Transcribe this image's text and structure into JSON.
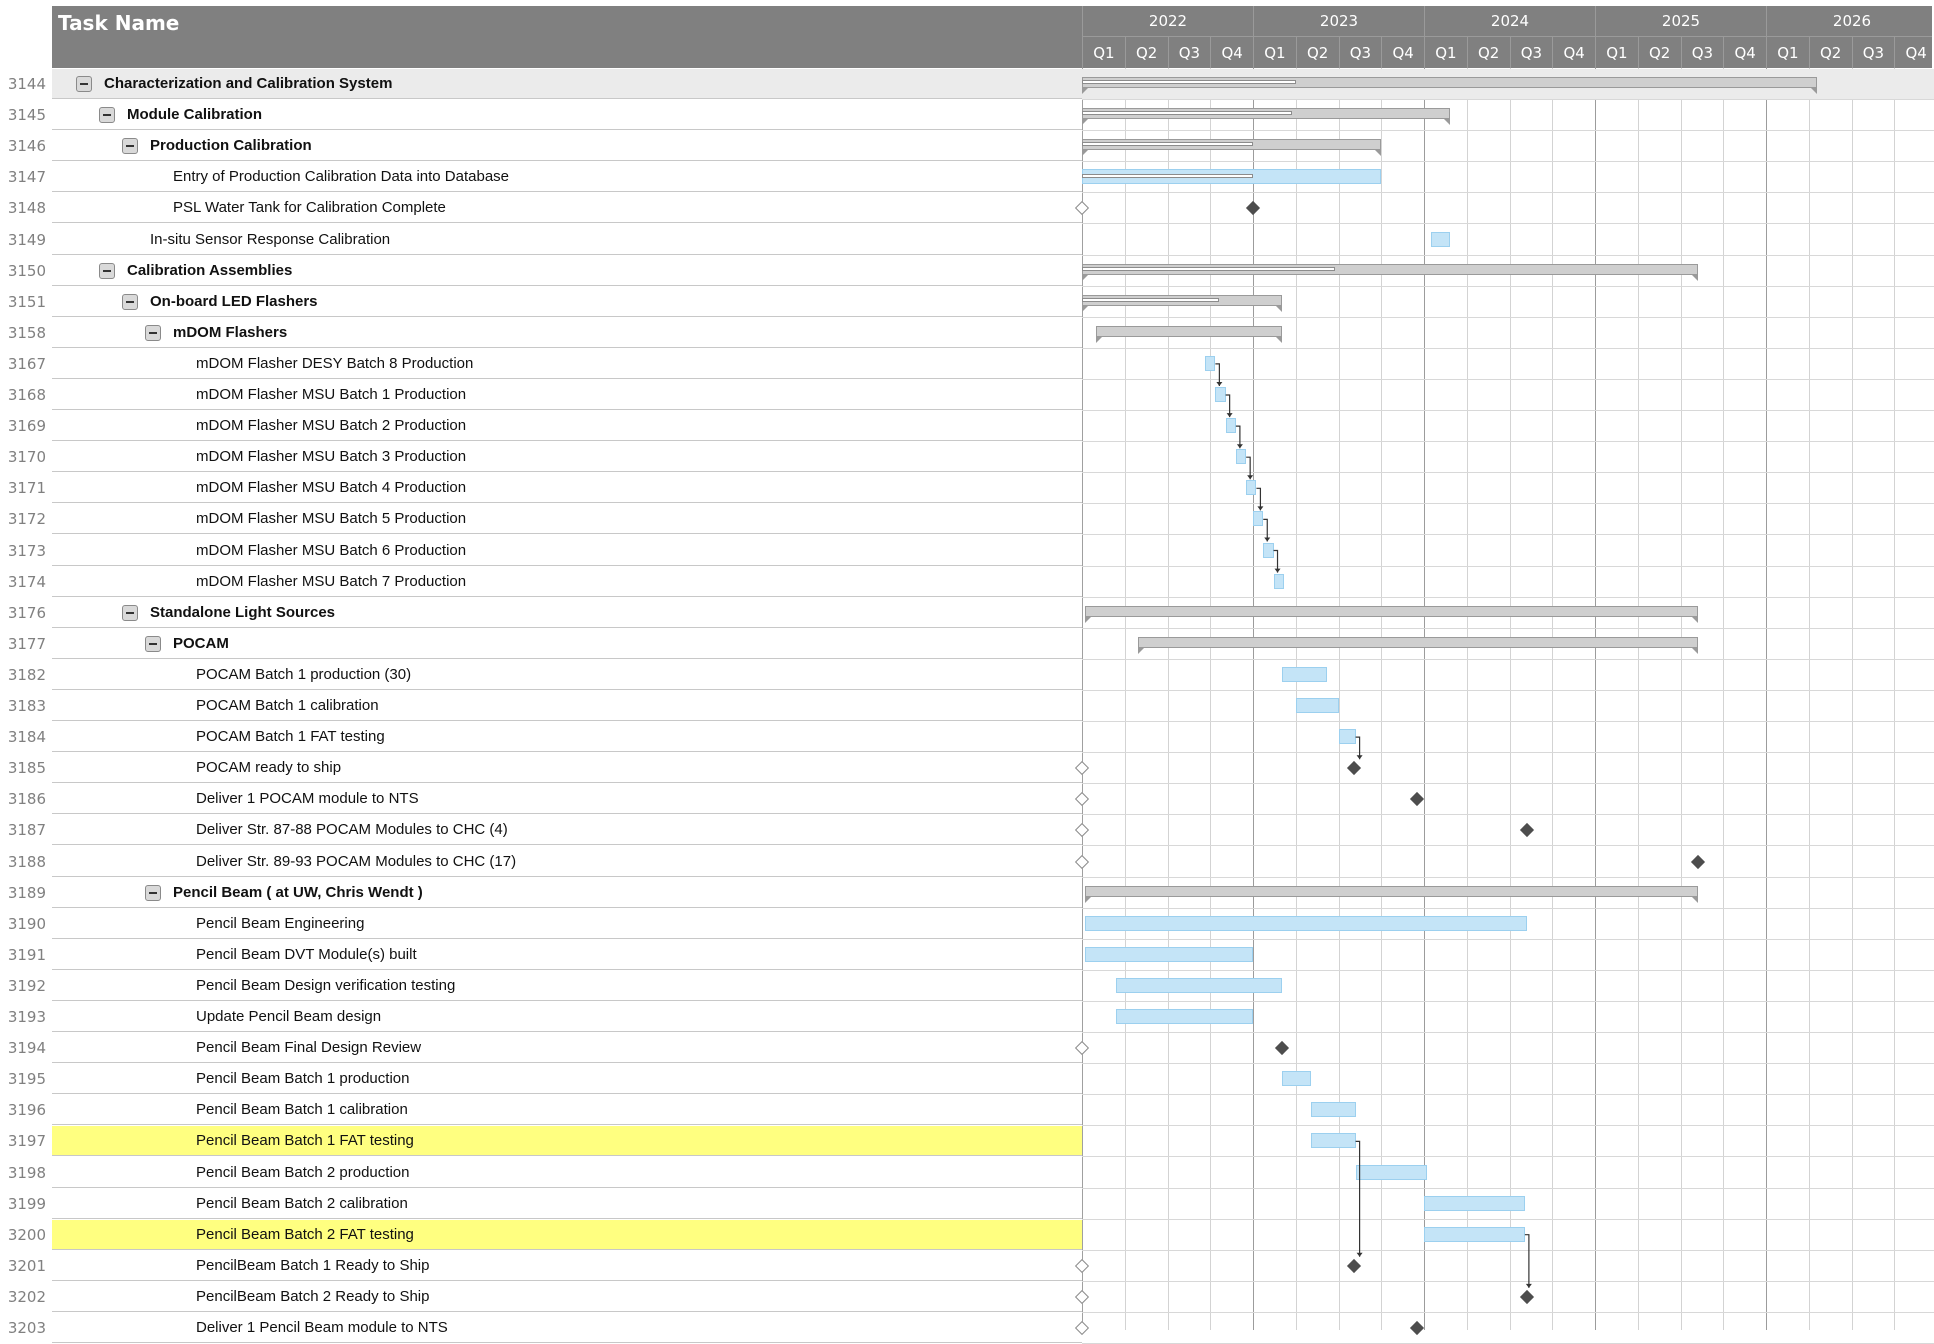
{
  "header": {
    "task_name_label": "Task Name",
    "years": [
      "2022",
      "2023",
      "2024",
      "2025",
      "2026"
    ],
    "quarters": [
      "Q1",
      "Q2",
      "Q3",
      "Q4"
    ]
  },
  "colors": {
    "header_bg": "#808080",
    "task_bar": "#c4e4f7",
    "summary_bar": "#cfcfcf",
    "milestone": "#4d4d4d",
    "highlight": "#ffff80"
  },
  "rows": [
    {
      "id": "3144",
      "name": "Characterization and Calibration System",
      "level": 0,
      "summary": true,
      "top": true,
      "bar": {
        "type": "summary",
        "start": 0.0,
        "end": 4.3,
        "progress": 1.25
      }
    },
    {
      "id": "3145",
      "name": "Module Calibration",
      "level": 1,
      "summary": true,
      "bar": {
        "type": "summary",
        "start": 0.0,
        "end": 2.15,
        "progress": 1.23
      }
    },
    {
      "id": "3146",
      "name": "Production Calibration",
      "level": 2,
      "summary": true,
      "bar": {
        "type": "summary",
        "start": 0.0,
        "end": 1.75,
        "progress": 1.0
      }
    },
    {
      "id": "3147",
      "name": "Entry of Production Calibration Data into Database",
      "level": 3,
      "summary": false,
      "bar": {
        "type": "task",
        "start": 0.0,
        "end": 1.75,
        "progress": 1.0
      }
    },
    {
      "id": "3148",
      "name": "PSL Water Tank for Calibration Complete",
      "level": 3,
      "summary": false,
      "bar": {
        "type": "milestone",
        "at": 1.0,
        "baseline": 0.0
      }
    },
    {
      "id": "3149",
      "name": "In-situ Sensor Response Calibration",
      "level": 2,
      "summary": false,
      "bar": {
        "type": "task",
        "start": 2.04,
        "end": 2.15
      }
    },
    {
      "id": "3150",
      "name": "Calibration Assemblies",
      "level": 1,
      "summary": true,
      "bar": {
        "type": "summary",
        "start": 0.0,
        "end": 3.6,
        "progress": 1.48
      }
    },
    {
      "id": "3151",
      "name": "On-board LED Flashers",
      "level": 2,
      "summary": true,
      "bar": {
        "type": "summary",
        "start": 0.0,
        "end": 1.17,
        "progress": 0.8
      }
    },
    {
      "id": "3158",
      "name": "mDOM Flashers",
      "level": 3,
      "summary": true,
      "bar": {
        "type": "summary",
        "start": 0.08,
        "end": 1.17
      }
    },
    {
      "id": "3167",
      "name": "mDOM Flasher DESY Batch 8 Production",
      "level": 4,
      "summary": false,
      "bar": {
        "type": "task",
        "start": 0.72,
        "end": 0.78
      }
    },
    {
      "id": "3168",
      "name": "mDOM Flasher MSU Batch 1 Production",
      "level": 4,
      "summary": false,
      "bar": {
        "type": "task",
        "start": 0.78,
        "end": 0.84
      }
    },
    {
      "id": "3169",
      "name": "mDOM Flasher MSU Batch 2 Production",
      "level": 4,
      "summary": false,
      "bar": {
        "type": "task",
        "start": 0.84,
        "end": 0.9
      }
    },
    {
      "id": "3170",
      "name": "mDOM Flasher MSU Batch 3 Production",
      "level": 4,
      "summary": false,
      "bar": {
        "type": "task",
        "start": 0.9,
        "end": 0.96
      }
    },
    {
      "id": "3171",
      "name": "mDOM Flasher MSU Batch 4 Production",
      "level": 4,
      "summary": false,
      "bar": {
        "type": "task",
        "start": 0.96,
        "end": 1.02
      }
    },
    {
      "id": "3172",
      "name": "mDOM Flasher MSU Batch 5 Production",
      "level": 4,
      "summary": false,
      "bar": {
        "type": "task",
        "start": 1.0,
        "end": 1.06
      }
    },
    {
      "id": "3173",
      "name": "mDOM Flasher MSU Batch 6 Production",
      "level": 4,
      "summary": false,
      "bar": {
        "type": "task",
        "start": 1.06,
        "end": 1.12
      }
    },
    {
      "id": "3174",
      "name": "mDOM Flasher MSU Batch 7 Production",
      "level": 4,
      "summary": false,
      "bar": {
        "type": "task",
        "start": 1.12,
        "end": 1.18
      }
    },
    {
      "id": "3176",
      "name": "Standalone Light Sources",
      "level": 2,
      "summary": true,
      "bar": {
        "type": "summary",
        "start": 0.02,
        "end": 3.6
      }
    },
    {
      "id": "3177",
      "name": "POCAM",
      "level": 3,
      "summary": true,
      "bar": {
        "type": "summary",
        "start": 0.33,
        "end": 3.6
      }
    },
    {
      "id": "3182",
      "name": "POCAM Batch 1 production (30)",
      "level": 4,
      "summary": false,
      "bar": {
        "type": "task",
        "start": 1.17,
        "end": 1.43
      }
    },
    {
      "id": "3183",
      "name": "POCAM Batch 1 calibration",
      "level": 4,
      "summary": false,
      "bar": {
        "type": "task",
        "start": 1.25,
        "end": 1.5
      }
    },
    {
      "id": "3184",
      "name": "POCAM Batch 1 FAT testing",
      "level": 4,
      "summary": false,
      "bar": {
        "type": "task",
        "start": 1.5,
        "end": 1.6
      }
    },
    {
      "id": "3185",
      "name": "POCAM ready to ship",
      "level": 4,
      "summary": false,
      "bar": {
        "type": "milestone",
        "at": 1.59,
        "baseline": 0.0
      }
    },
    {
      "id": "3186",
      "name": "Deliver 1 POCAM module to NTS",
      "level": 4,
      "summary": false,
      "bar": {
        "type": "milestone",
        "at": 1.96,
        "baseline": 0.0
      }
    },
    {
      "id": "3187",
      "name": "Deliver Str. 87-88 POCAM Modules to CHC (4)",
      "level": 4,
      "summary": false,
      "bar": {
        "type": "milestone",
        "at": 2.6,
        "baseline": 0.0
      }
    },
    {
      "id": "3188",
      "name": "Deliver Str. 89-93 POCAM Modules to CHC (17)",
      "level": 4,
      "summary": false,
      "bar": {
        "type": "milestone",
        "at": 3.6,
        "baseline": 0.0
      }
    },
    {
      "id": "3189",
      "name": "Pencil Beam ( at UW, Chris Wendt )",
      "level": 3,
      "summary": true,
      "bar": {
        "type": "summary",
        "start": 0.02,
        "end": 3.6
      }
    },
    {
      "id": "3190",
      "name": "Pencil Beam Engineering",
      "level": 4,
      "summary": false,
      "bar": {
        "type": "task",
        "start": 0.02,
        "end": 2.6
      }
    },
    {
      "id": "3191",
      "name": "Pencil Beam DVT Module(s) built",
      "level": 4,
      "summary": false,
      "bar": {
        "type": "task",
        "start": 0.02,
        "end": 1.0
      }
    },
    {
      "id": "3192",
      "name": "Pencil Beam Design verification testing",
      "level": 4,
      "summary": false,
      "bar": {
        "type": "task",
        "start": 0.2,
        "end": 1.17
      }
    },
    {
      "id": "3193",
      "name": "Update Pencil Beam design",
      "level": 4,
      "summary": false,
      "bar": {
        "type": "task",
        "start": 0.2,
        "end": 1.0
      }
    },
    {
      "id": "3194",
      "name": "Pencil Beam Final Design Review",
      "level": 4,
      "summary": false,
      "bar": {
        "type": "milestone",
        "at": 1.17,
        "baseline": 0.0
      }
    },
    {
      "id": "3195",
      "name": "Pencil Beam Batch 1 production",
      "level": 4,
      "summary": false,
      "bar": {
        "type": "task",
        "start": 1.17,
        "end": 1.34
      }
    },
    {
      "id": "3196",
      "name": "Pencil Beam Batch 1 calibration",
      "level": 4,
      "summary": false,
      "bar": {
        "type": "task",
        "start": 1.34,
        "end": 1.6
      }
    },
    {
      "id": "3197",
      "name": "Pencil Beam Batch 1 FAT testing",
      "level": 4,
      "summary": false,
      "highlight": true,
      "bar": {
        "type": "task",
        "start": 1.34,
        "end": 1.6
      }
    },
    {
      "id": "3198",
      "name": "Pencil Beam Batch 2 production",
      "level": 4,
      "summary": false,
      "bar": {
        "type": "task",
        "start": 1.6,
        "end": 2.02
      }
    },
    {
      "id": "3199",
      "name": "Pencil Beam Batch 2 calibration",
      "level": 4,
      "summary": false,
      "bar": {
        "type": "task",
        "start": 2.0,
        "end": 2.59
      }
    },
    {
      "id": "3200",
      "name": "Pencil Beam Batch 2 FAT testing",
      "level": 4,
      "summary": false,
      "highlight": true,
      "bar": {
        "type": "task",
        "start": 2.0,
        "end": 2.59
      }
    },
    {
      "id": "3201",
      "name": "PencilBeam Batch 1 Ready to Ship",
      "level": 4,
      "summary": false,
      "bar": {
        "type": "milestone",
        "at": 1.59,
        "baseline": 0.0
      }
    },
    {
      "id": "3202",
      "name": "PencilBeam Batch 2 Ready to Ship",
      "level": 4,
      "summary": false,
      "bar": {
        "type": "milestone",
        "at": 2.6,
        "baseline": 0.0
      }
    },
    {
      "id": "3203",
      "name": "Deliver 1 Pencil Beam module to NTS",
      "level": 4,
      "summary": false,
      "bar": {
        "type": "milestone",
        "at": 1.96,
        "baseline": 0.0
      }
    }
  ],
  "links": [
    {
      "from": "3167",
      "to": "3168"
    },
    {
      "from": "3168",
      "to": "3169"
    },
    {
      "from": "3169",
      "to": "3170"
    },
    {
      "from": "3170",
      "to": "3171"
    },
    {
      "from": "3171",
      "to": "3172"
    },
    {
      "from": "3172",
      "to": "3173"
    },
    {
      "from": "3173",
      "to": "3174"
    },
    {
      "from": "3184",
      "to": "3185"
    },
    {
      "from": "3197",
      "to": "3201"
    },
    {
      "from": "3200",
      "to": "3202"
    }
  ]
}
